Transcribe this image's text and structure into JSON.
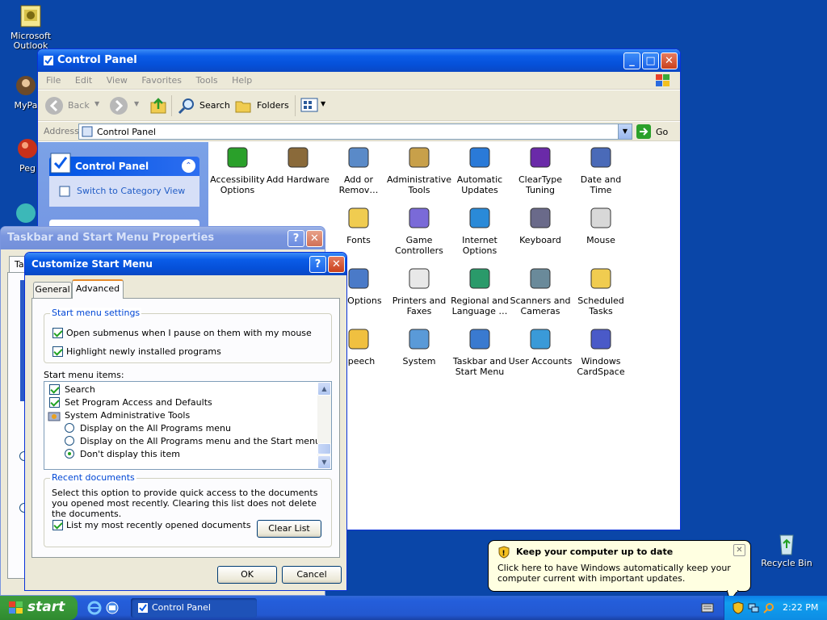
{
  "desktop": {
    "icons": [
      {
        "label": "Microsoft Outlook"
      },
      {
        "label": "MyPa"
      },
      {
        "label": "Peg"
      },
      {
        "label": "Recycle Bin"
      }
    ]
  },
  "control_panel": {
    "title": "Control Panel",
    "menu": [
      "File",
      "Edit",
      "View",
      "Favorites",
      "Tools",
      "Help"
    ],
    "toolbar": {
      "back": "Back",
      "search": "Search",
      "folders": "Folders"
    },
    "address_label": "Address",
    "address_value": "Control Panel",
    "go_label": "Go",
    "side_panel": {
      "title": "Control Panel",
      "link": "Switch to Category View"
    },
    "items": [
      {
        "label": "Accessibility Options",
        "icon": "accessibility-icon"
      },
      {
        "label": "Add Hardware",
        "icon": "hardware-icon"
      },
      {
        "label": "Add or Remov…",
        "icon": "add-remove-programs-icon"
      },
      {
        "label": "Administrative Tools",
        "icon": "admin-tools-icon"
      },
      {
        "label": "Automatic Updates",
        "icon": "windows-update-icon"
      },
      {
        "label": "ClearType Tuning",
        "icon": "cleartype-icon"
      },
      {
        "label": "Date and Time",
        "icon": "clock-icon"
      },
      {
        "label": "Fonts",
        "icon": "fonts-folder-icon"
      },
      {
        "label": "Game Controllers",
        "icon": "gamepad-icon"
      },
      {
        "label": "Internet Options",
        "icon": "globe-icon"
      },
      {
        "label": "Keyboard",
        "icon": "keyboard-icon"
      },
      {
        "label": "Mouse",
        "icon": "mouse-icon"
      },
      {
        "label": "er Options",
        "icon": "power-options-icon"
      },
      {
        "label": "Printers and Faxes",
        "icon": "printer-icon"
      },
      {
        "label": "Regional and Language …",
        "icon": "regional-globe-icon"
      },
      {
        "label": "Scanners and Cameras",
        "icon": "scanner-icon"
      },
      {
        "label": "Scheduled Tasks",
        "icon": "scheduled-tasks-icon"
      },
      {
        "label": "Speech",
        "icon": "speech-icon"
      },
      {
        "label": "System",
        "icon": "system-icon"
      },
      {
        "label": "Taskbar and Start Menu",
        "icon": "taskbar-icon"
      },
      {
        "label": "User Accounts",
        "icon": "users-icon"
      },
      {
        "label": "Windows CardSpace",
        "icon": "cardspace-icon"
      }
    ]
  },
  "taskbar_props": {
    "title": "Taskbar and Start Menu Properties",
    "tab_fragment": "Ta"
  },
  "customize": {
    "title": "Customize Start Menu",
    "tabs": [
      "General",
      "Advanced"
    ],
    "settings_group": "Start menu settings",
    "settings": [
      {
        "label": "Open submenus when I pause on them with my mouse",
        "checked": true
      },
      {
        "label": "Highlight newly installed programs",
        "checked": true
      }
    ],
    "items_label": "Start menu items:",
    "list": [
      {
        "type": "check",
        "label": "Search"
      },
      {
        "type": "check",
        "label": "Set Program Access and Defaults"
      },
      {
        "type": "header",
        "label": "System Administrative Tools"
      },
      {
        "type": "radio",
        "label": "Display on the All Programs menu",
        "selected": false
      },
      {
        "type": "radio",
        "label": "Display on the All Programs menu and the Start menu",
        "selected": false
      },
      {
        "type": "radio",
        "label": "Don't display this item",
        "selected": true
      }
    ],
    "recent_group": "Recent documents",
    "recent_desc": "Select this option to provide quick access to the documents you opened most recently.  Clearing this list does not delete the documents.",
    "recent_check": "List my most recently opened documents",
    "clear_list": "Clear List",
    "ok": "OK",
    "cancel": "Cancel"
  },
  "balloon": {
    "title": "Keep your computer up to date",
    "text": "Click here to have Windows automatically keep your computer current with important updates."
  },
  "taskbar": {
    "start": "start",
    "task": "Control Panel",
    "clock": "2:22 PM"
  }
}
